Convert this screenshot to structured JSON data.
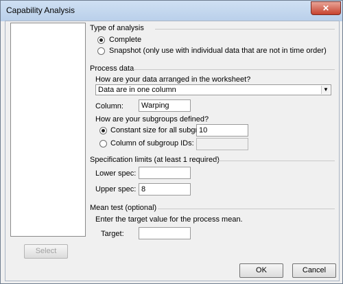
{
  "window": {
    "title": "Capability Analysis",
    "close_label": "✕"
  },
  "buttons": {
    "select": "Select",
    "ok": "OK",
    "cancel": "Cancel"
  },
  "type_of_analysis": {
    "heading": "Type of analysis",
    "options": [
      {
        "label": "Complete",
        "selected": true
      },
      {
        "label": "Snapshot (only use with individual data that are not in time order)",
        "selected": false
      }
    ]
  },
  "process_data": {
    "heading": "Process data",
    "arrangement_question": "How are your data arranged in the worksheet?",
    "arrangement_value": "Data are in one column",
    "column_label": "Column:",
    "column_value": "Warping",
    "subgroups_question": "How are your subgroups defined?",
    "subgroup_options": [
      {
        "label": "Constant size for all subgroups:",
        "selected": true,
        "value": "10"
      },
      {
        "label": "Column of subgroup IDs:",
        "selected": false,
        "value": ""
      }
    ]
  },
  "spec_limits": {
    "heading": "Specification limits (at least 1 required)",
    "lower_label": "Lower spec:",
    "lower_value": "",
    "upper_label": "Upper spec:",
    "upper_value": "8"
  },
  "mean_test": {
    "heading": "Mean test (optional)",
    "instruction": "Enter the target value for the process mean.",
    "target_label": "Target:",
    "target_value": ""
  }
}
